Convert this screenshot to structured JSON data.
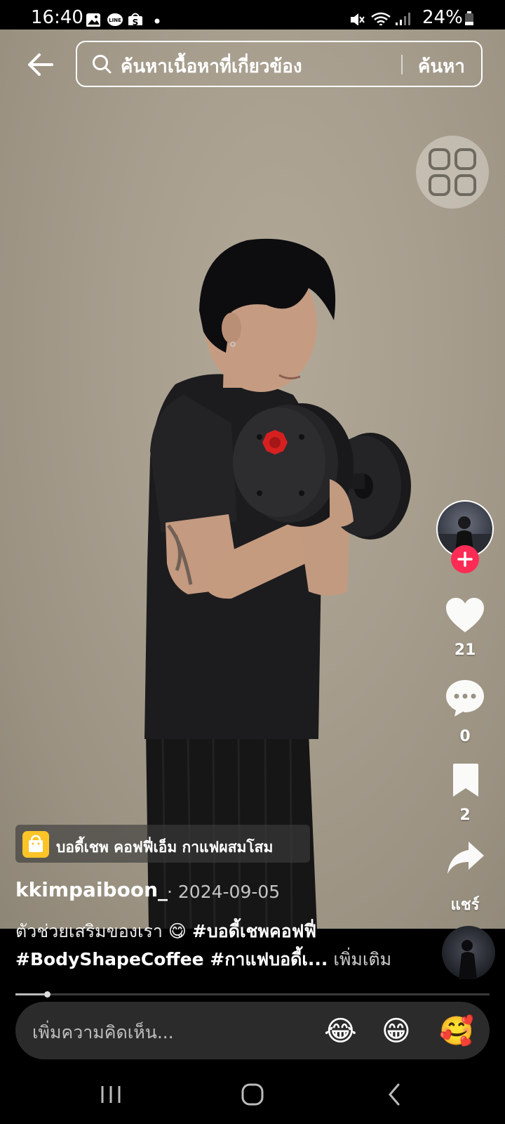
{
  "status_bar": {
    "time": "16:40",
    "battery": "24%",
    "left_icons": [
      "gallery-icon",
      "line-icon",
      "shopee-icon",
      "dot-icon"
    ],
    "right_icons": [
      "mute-icon",
      "wifi-icon",
      "signal-icon",
      "battery-icon"
    ]
  },
  "search": {
    "query": "ค้นหาเนื้อหาที่เกี่ยวข้อง",
    "submit_label": "ค้นหา"
  },
  "rail": {
    "likes": "21",
    "comments": "0",
    "saves": "2",
    "share_label": "แชร์"
  },
  "product": {
    "label": "บอดี้เชพ คอฟฟี่เอ็ม กาแฟผสมโสม"
  },
  "post": {
    "username": "kkimpaiboon_",
    "date": "· 2024-09-05",
    "caption_text": "ตัวช่วยเสริมของเรา 😋 ",
    "caption_tag1": "#บอดี้เชพคอฟฟี่",
    "caption_tag2": "#BodyShapeCoffee #กาแฟบอดี้เ...",
    "see_more": "เพิ่มเติม"
  },
  "playback": {
    "progress": 0.06
  },
  "comment": {
    "placeholder": "เพิ่มความคิดเห็น...",
    "emojis": [
      "😂",
      "😁",
      "🥰"
    ]
  },
  "colors": {
    "accent": "#fe2c55",
    "shop": "#fcc427"
  }
}
